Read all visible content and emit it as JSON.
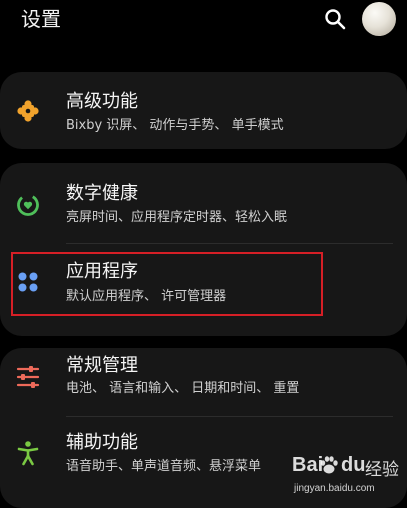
{
  "header": {
    "title": "设置",
    "search_icon": "search-icon",
    "avatar_icon": "avatar"
  },
  "items": [
    {
      "title": "高级功能",
      "subtitle": "Bixby 识屏、 动作与手势、 单手模式",
      "icon": "puzzle-icon",
      "icon_color": "#f2a32c"
    },
    {
      "title": "数字健康",
      "subtitle": "亮屏时间、应用程序定时器、轻松入眠",
      "icon": "digital-wellbeing-icon",
      "icon_color": "#4fbf5a"
    },
    {
      "title": "应用程序",
      "subtitle": "默认应用程序、 许可管理器",
      "icon": "apps-grid-icon",
      "icon_color": "#6aa0f5"
    },
    {
      "title": "常规管理",
      "subtitle": "电池、 语言和输入、 日期和时间、 重置",
      "icon": "sliders-icon",
      "icon_color": "#ee6a5a"
    },
    {
      "title": "辅助功能",
      "subtitle": "语音助手、单声道音频、悬浮菜单",
      "icon": "accessibility-icon",
      "icon_color": "#7ac943"
    }
  ],
  "highlight_color": "#d61f26",
  "watermark": {
    "brand_left": "Bai",
    "brand_right": "du",
    "product": "经验",
    "url": "jingyan.baidu.com"
  }
}
